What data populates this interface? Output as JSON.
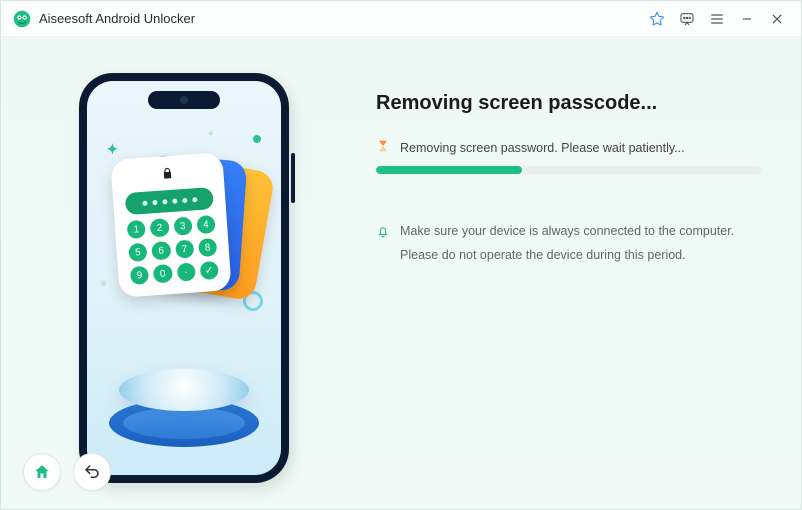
{
  "titlebar": {
    "app_name": "Aiseesoft Android Unlocker"
  },
  "main": {
    "heading": "Removing screen passcode...",
    "status_text": "Removing screen password. Please wait patiently...",
    "progress_percent": 38,
    "notice_text": "Make sure your device is always connected to the computer. Please do not operate the device during this period."
  },
  "colors": {
    "accent": "#1dbf84"
  }
}
